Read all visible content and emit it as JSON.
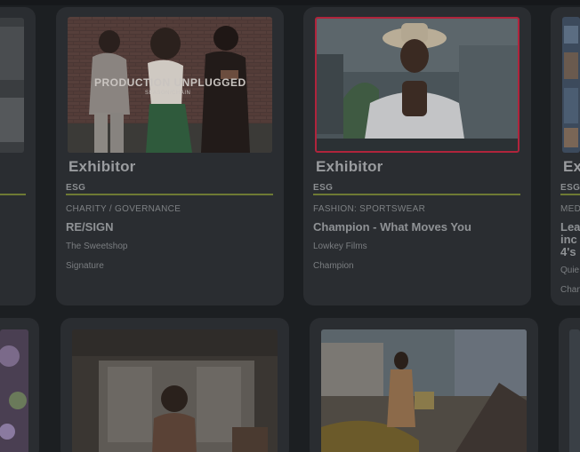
{
  "cards": [
    {
      "type_label": "Exhibitor",
      "tag": "ESG",
      "category": "CHARITY / GOVERNANCE",
      "title": "RE/SIGN",
      "company": "The Sweetshop",
      "client": "Signature",
      "thumb_text": "PRODUCTION UNPLUGGED",
      "thumb_subtext": "SEASON/CHAIN"
    },
    {
      "type_label": "Exhibitor",
      "tag": "ESG",
      "category": "FASHION: SPORTSWEAR",
      "title": "Champion - What Moves You",
      "company": "Lowkey Films",
      "client": "Champion"
    },
    {
      "type_label": "Ex",
      "tag": "ESG",
      "category": "MED",
      "title_lines": [
        "Lea",
        "inc",
        "4's"
      ],
      "company": "Quie",
      "client": "Chan"
    }
  ],
  "colors": {
    "background": "#1c1f22",
    "card": "#2a2d31",
    "accent_rule": "#6e7a34",
    "thumb_border_red": "#b0243c"
  }
}
